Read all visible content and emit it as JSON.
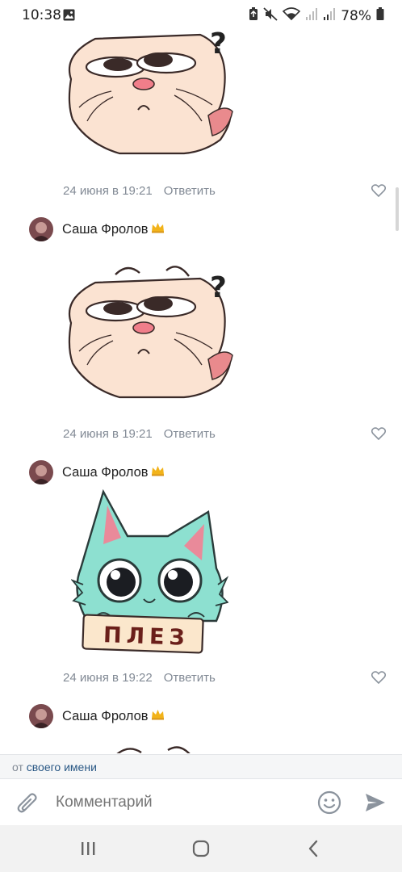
{
  "status_bar": {
    "time": "10:38",
    "battery": "78%"
  },
  "comments": [
    {
      "author": "",
      "date": "24 июня в 19:21",
      "reply": "Ответить",
      "sticker": "confused-cat-sticker"
    },
    {
      "author": "Саша Фролов",
      "date": "24 июня в 19:21",
      "reply": "Ответить",
      "sticker": "confused-cat-sticker"
    },
    {
      "author": "Саша Фролов",
      "date": "24 июня в 19:22",
      "reply": "Ответить",
      "sticker": "please-cat-sticker",
      "sticker_text": "ПЛЕЗ"
    },
    {
      "author": "Саша Фролов"
    }
  ],
  "from_bar": {
    "prefix": "от",
    "link": "своего имени"
  },
  "composer": {
    "placeholder": "Комментарий"
  },
  "colors": {
    "meta_text": "#828a95",
    "link": "#2a5885",
    "sticker_teal": "#8de0d0"
  }
}
